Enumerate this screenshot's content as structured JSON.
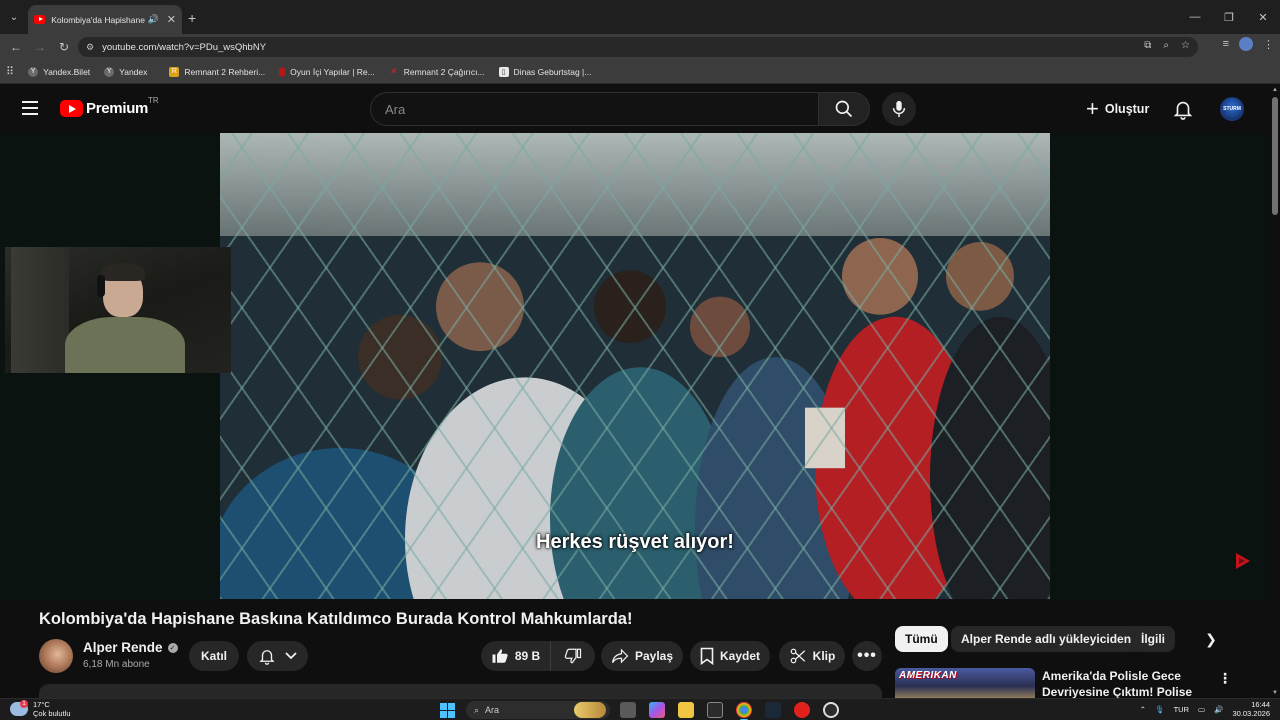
{
  "browser": {
    "tab": {
      "title": "Kolombiya'da Hapishane Ba",
      "favicon": "youtube-favicon-icon"
    },
    "url": "youtube.com/watch?v=PDu_wsQhbNY",
    "bookmarks": [
      {
        "label": "Yandex.Bilet",
        "icon": "yandex-icon",
        "color": "#6b6b6b"
      },
      {
        "label": "Yandex",
        "icon": "yandex-icon",
        "color": "#6b6b6b"
      },
      {
        "label": "Remnant 2 Rehberi...",
        "icon": "remnant-icon",
        "color": "#d9a21b"
      },
      {
        "label": "Oyun İçi Yapılar | Re...",
        "icon": "red-drop-icon",
        "color": "#b3171c"
      },
      {
        "label": "Remnant 2 Çağırıcı...",
        "icon": "x-icon",
        "color": "#b3171c"
      },
      {
        "label": "Dinas Geburtstag |...",
        "icon": "page-icon",
        "color": "#e8e8e8"
      }
    ]
  },
  "youtube": {
    "logo_text": "Premium",
    "region": "TR",
    "search_placeholder": "Ara",
    "create_label": "Oluştur",
    "avatar_text": "STURM"
  },
  "video": {
    "subtitle": "Herkes rüşvet alıyor!",
    "title": "Kolombiya'da Hapishane Baskına Katıldımco Burada Kontrol Mahkumlarda!",
    "channel": {
      "name": "Alper Rende",
      "subscribers": "6,18 Mn abone"
    },
    "actions": {
      "join": "Katıl",
      "likes": "89 B",
      "share": "Paylaş",
      "save": "Kaydet",
      "clip": "Klip"
    }
  },
  "sidebar": {
    "chips": [
      "Tümü",
      "Alper Rende adlı yükleyiciden",
      "İlgili"
    ],
    "recommendation": {
      "thumb_text": "AMERIKAN",
      "title": "Amerika'da Polisle Gece Devriyesine Çıktım! Polise Kiif"
    }
  },
  "taskbar": {
    "temperature": "17°C",
    "weather": "Çok bulutlu",
    "search": "Ara",
    "language": "TUR",
    "time": "16:44",
    "date": "30.03.2026",
    "weather_badge": "1"
  }
}
